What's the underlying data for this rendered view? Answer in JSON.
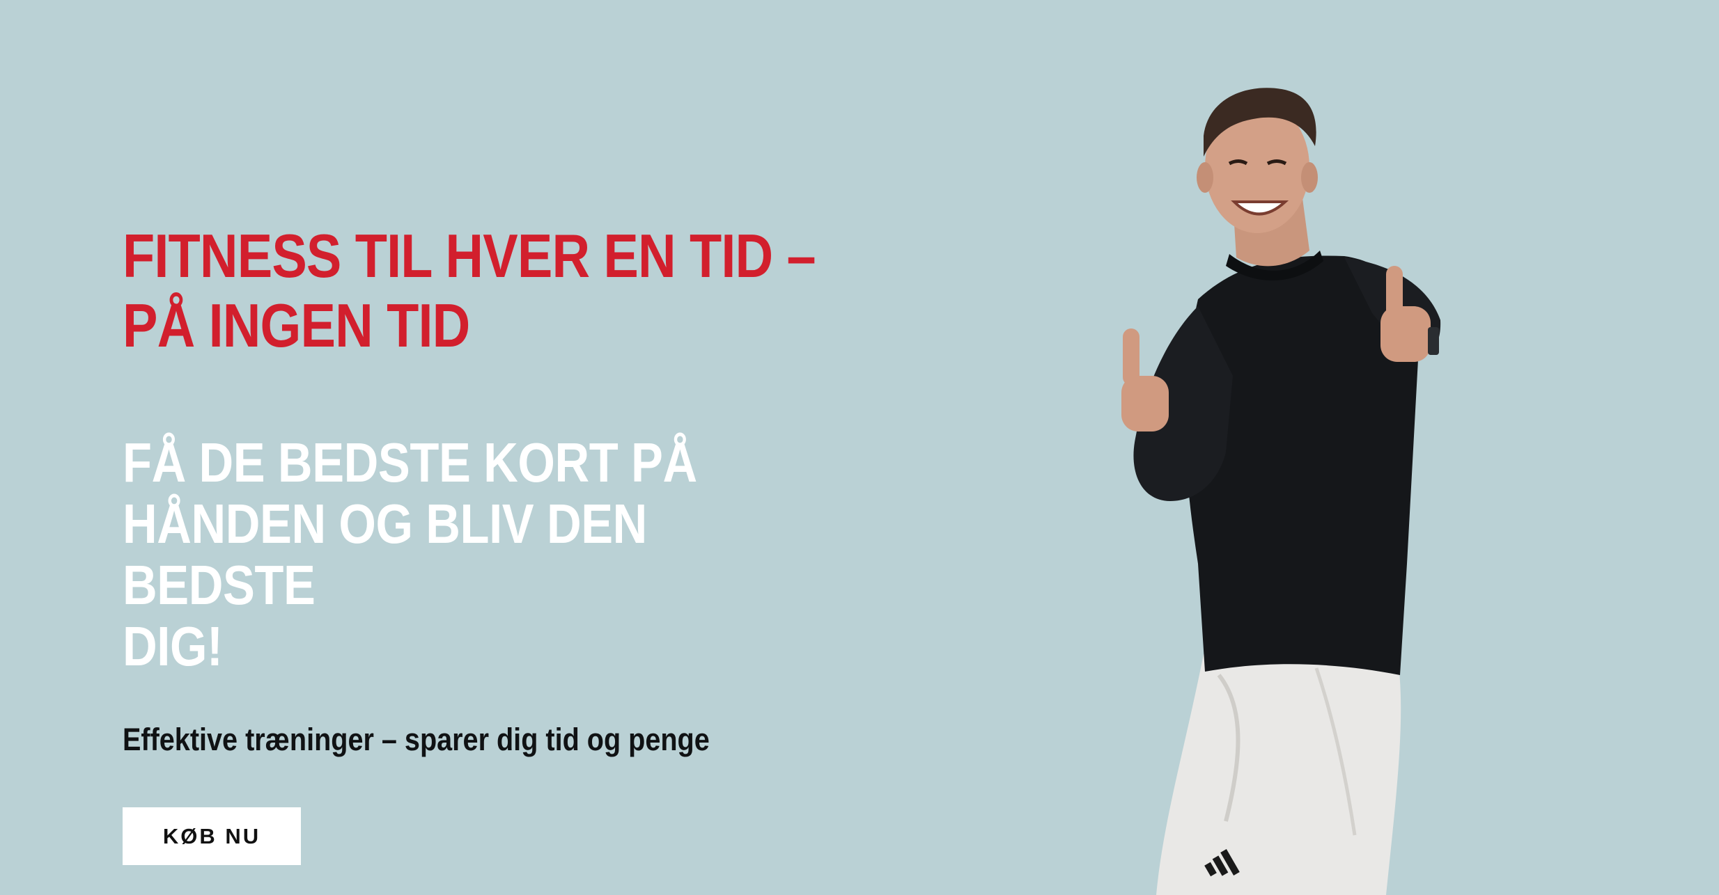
{
  "hero": {
    "headline_line1": "FITNESS TIL HVER EN TID –",
    "headline_line2": "PÅ INGEN TID",
    "subheadline_line1": "FÅ DE BEDSTE KORT PÅ",
    "subheadline_line2": "HÅNDEN OG BLIV DEN BEDSTE",
    "subheadline_line3": "DIG!",
    "tagline": "Effektive træninger – sparer dig tid og penge",
    "cta_label": "KØB NU"
  },
  "colors": {
    "background": "#bad1d5",
    "headline": "#d21f2d",
    "subheadline": "#ffffff",
    "tagline": "#101214",
    "cta_background": "#ffffff",
    "cta_text": "#111111"
  },
  "images": {
    "person": "man-thumbs-up-photo"
  }
}
